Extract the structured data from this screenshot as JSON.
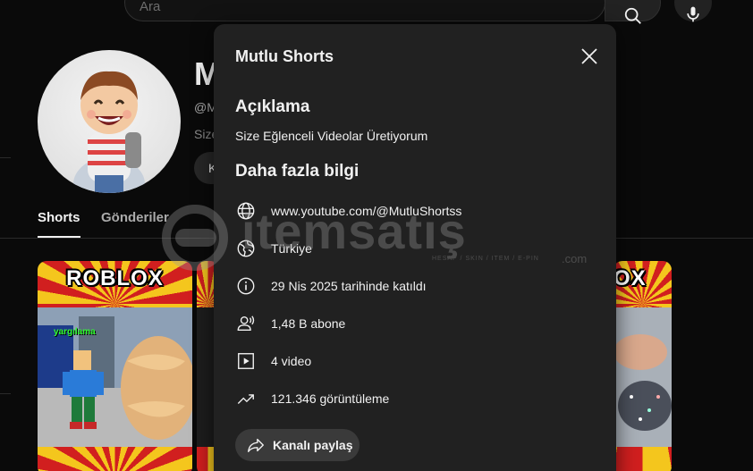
{
  "search": {
    "placeholder": "Ara"
  },
  "channel": {
    "name_visible": "M",
    "handle_visible": "@M",
    "sub_visible": "Size",
    "pill_visible": "K"
  },
  "tabs": [
    {
      "label": "Shorts"
    },
    {
      "label": "Gönderiler"
    }
  ],
  "thumbnails": [
    {
      "title": "ROBLOX",
      "overlay": "yargılama"
    },
    {
      "title": ""
    },
    {
      "title": "OX"
    }
  ],
  "dialog": {
    "title": "Mutlu Shorts",
    "description_heading": "Açıklama",
    "description": "Size Eğlenceli Videolar Üretiyorum",
    "more_info_heading": "Daha fazla bilgi",
    "rows": [
      {
        "icon": "globe-icon",
        "text": "www.youtube.com/@MutluShortss"
      },
      {
        "icon": "location-globe-icon",
        "text": "Türkiye"
      },
      {
        "icon": "info-icon",
        "text": "29 Nis 2025 tarihinde katıldı"
      },
      {
        "icon": "subscribers-icon",
        "text": "1,48 B abone"
      },
      {
        "icon": "video-icon",
        "text": "4 video"
      },
      {
        "icon": "trending-icon",
        "text": "121.346 görüntüleme"
      }
    ],
    "share_label": "Kanalı paylaş"
  },
  "watermark": {
    "text": "itemsatış",
    "sub": "HESAP / SKIN / ITEM / E-PIN",
    "domain": ".com"
  }
}
